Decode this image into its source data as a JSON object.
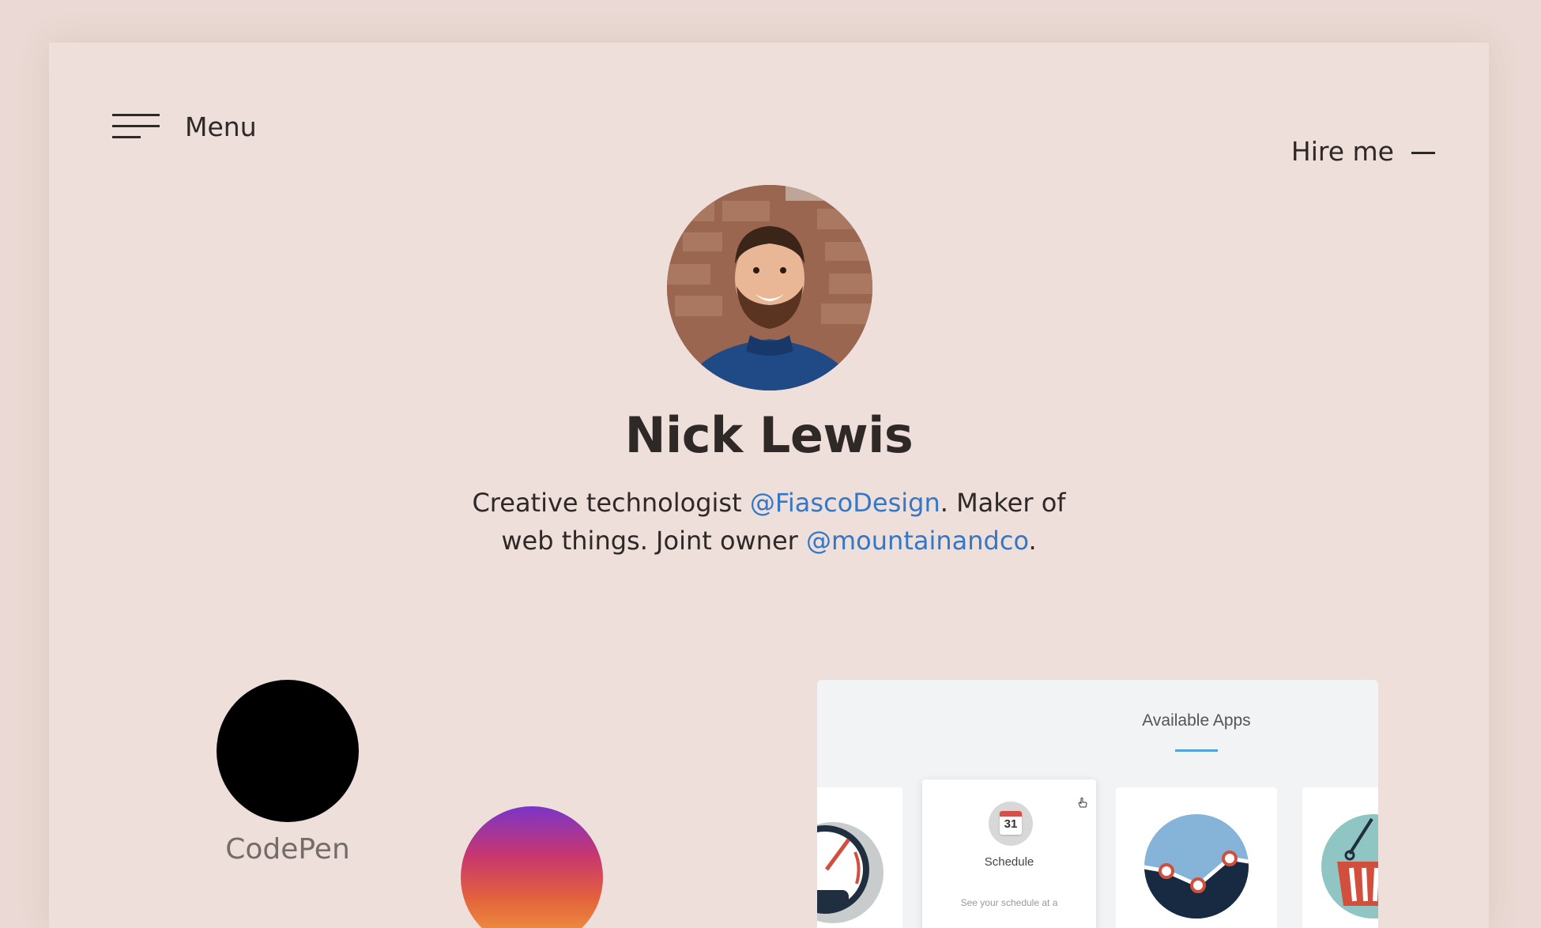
{
  "header": {
    "menu_label": "Menu",
    "hire_label": "Hire me"
  },
  "hero": {
    "name": "Nick Lewis",
    "bio_part1": "Creative technologist ",
    "bio_link1": "@FiascoDesign",
    "bio_part2": ". Maker of web things. Joint owner ",
    "bio_link2": "@mountainandco",
    "bio_part3": ".",
    "avatar_icon": "profile-photo"
  },
  "projects": {
    "codepen_label": "CodePen",
    "codepen_color": "#000000",
    "instagram_gradient": [
      "#7a35c8",
      "#c8376e",
      "#e3623c",
      "#f2a340"
    ]
  },
  "apps_panel": {
    "title": "Available Apps",
    "accent": "#4fa3d6",
    "featured_app": {
      "calendar_day": "31",
      "name": "Schedule",
      "description": "See your schedule at a"
    }
  },
  "colors": {
    "background": "#ead9d4",
    "card": "#eedfdb",
    "text": "#2e2826",
    "link": "#3377c8"
  }
}
